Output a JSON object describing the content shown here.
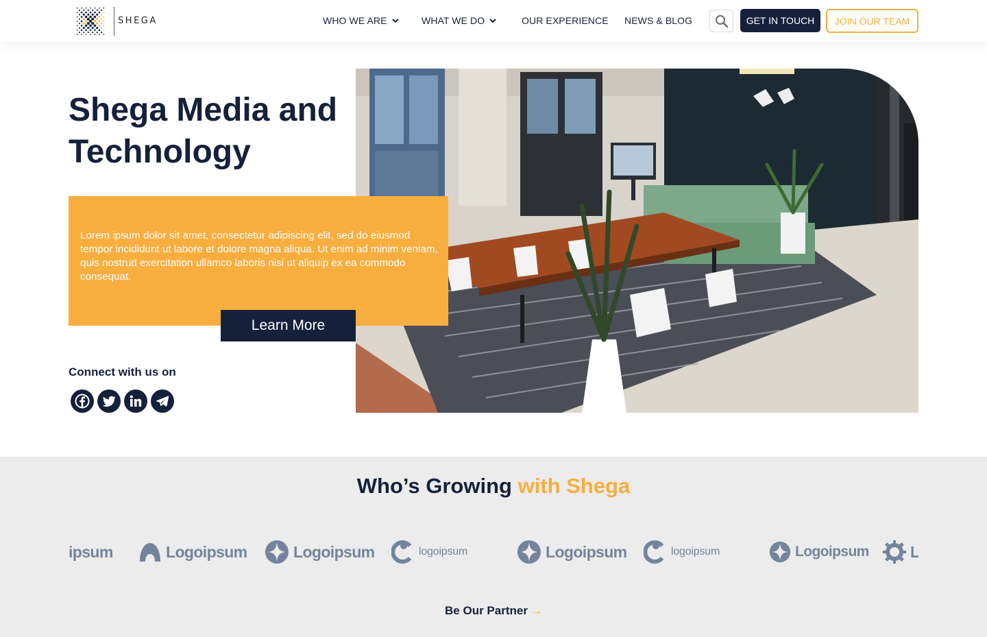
{
  "brand": {
    "name": "SHEGA",
    "accent_color": "#f8ae3e",
    "navy_color": "#15213b"
  },
  "nav": {
    "items": [
      {
        "label": "WHO WE ARE",
        "has_dropdown": true
      },
      {
        "label": "WHAT WE DO",
        "has_dropdown": true
      },
      {
        "label": "OUR EXPERIENCE",
        "has_dropdown": false
      },
      {
        "label": "NEWS & BLOG",
        "has_dropdown": false
      }
    ],
    "search_icon": "search-icon",
    "get_in_touch": "GET IN TOUCH",
    "join_team": "JOIN OUR TEAM"
  },
  "hero": {
    "title": "Shega Media and Technology",
    "description": "Lorem ipsum dolor sit amet, consectetur adipiscing elit, sed do eiusmod tempor incididunt ut labore et dolore magna aliqua. Ut enim ad minim veniam, quis nostrud exercitation ullamco laboris nisi ut aliquip ex ea commodo consequat.",
    "cta": "Learn More",
    "connect_label": "Connect with us on",
    "socials": [
      "facebook-icon",
      "twitter-icon",
      "linkedin-icon",
      "telegram-icon"
    ]
  },
  "partners": {
    "title_main": "Who’s Growing",
    "title_accent": "with Shega",
    "logos": [
      {
        "text": "ipsum",
        "icon": "partial-logo"
      },
      {
        "text": "Logoipsum",
        "icon": "arch-logo-icon"
      },
      {
        "text": "Logoipsum",
        "icon": "star-logo-icon"
      },
      {
        "text": "logoipsum",
        "icon": "c-logo-icon"
      },
      {
        "text": "Logoipsum",
        "icon": "star-logo-icon"
      },
      {
        "text": "logoipsum",
        "icon": "c-logo-icon"
      },
      {
        "text": "Logoipsum",
        "icon": "star-logo-icon"
      },
      {
        "text": "Lo",
        "icon": "gear-logo-icon"
      }
    ],
    "cta": "Be Our Partner",
    "cta_arrow": "→"
  }
}
